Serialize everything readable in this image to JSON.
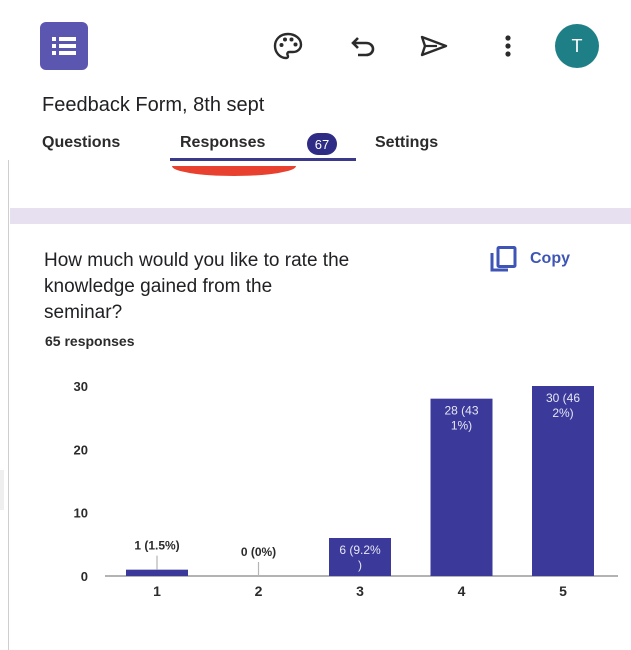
{
  "header": {
    "form_title": "Feedback Form, 8th sept",
    "avatar_initial": "T",
    "icons": [
      "forms-app-icon",
      "palette-icon",
      "undo-icon",
      "send-icon",
      "more-vert-icon"
    ]
  },
  "tabs": [
    {
      "label": "Questions"
    },
    {
      "label": "Responses",
      "badge": "67",
      "active": true
    },
    {
      "label": "Settings"
    }
  ],
  "question": {
    "line1": "How much would you like to rate the",
    "line2": "knowledge gained from the",
    "line3": "seminar?",
    "copy_label": "Copy",
    "responses_label": "65 responses"
  },
  "colors": {
    "accent": "#3b3a8a",
    "bar": "#3b3a9a",
    "avatar": "#1e7f86",
    "brand": "#5b57b0"
  },
  "chart_data": {
    "type": "bar",
    "categories": [
      "1",
      "2",
      "3",
      "4",
      "5"
    ],
    "values": [
      1,
      0,
      6,
      28,
      30
    ],
    "data_labels": [
      [
        "1 (1.5%)"
      ],
      [
        "0 (0%)"
      ],
      [
        "6 (9.2%",
        ")"
      ],
      [
        "28 (43",
        "1%)"
      ],
      [
        "30 (46",
        "2%)"
      ]
    ],
    "yticks": [
      "0",
      "10",
      "20",
      "30"
    ],
    "ylim": [
      0,
      30
    ],
    "grid": false
  }
}
